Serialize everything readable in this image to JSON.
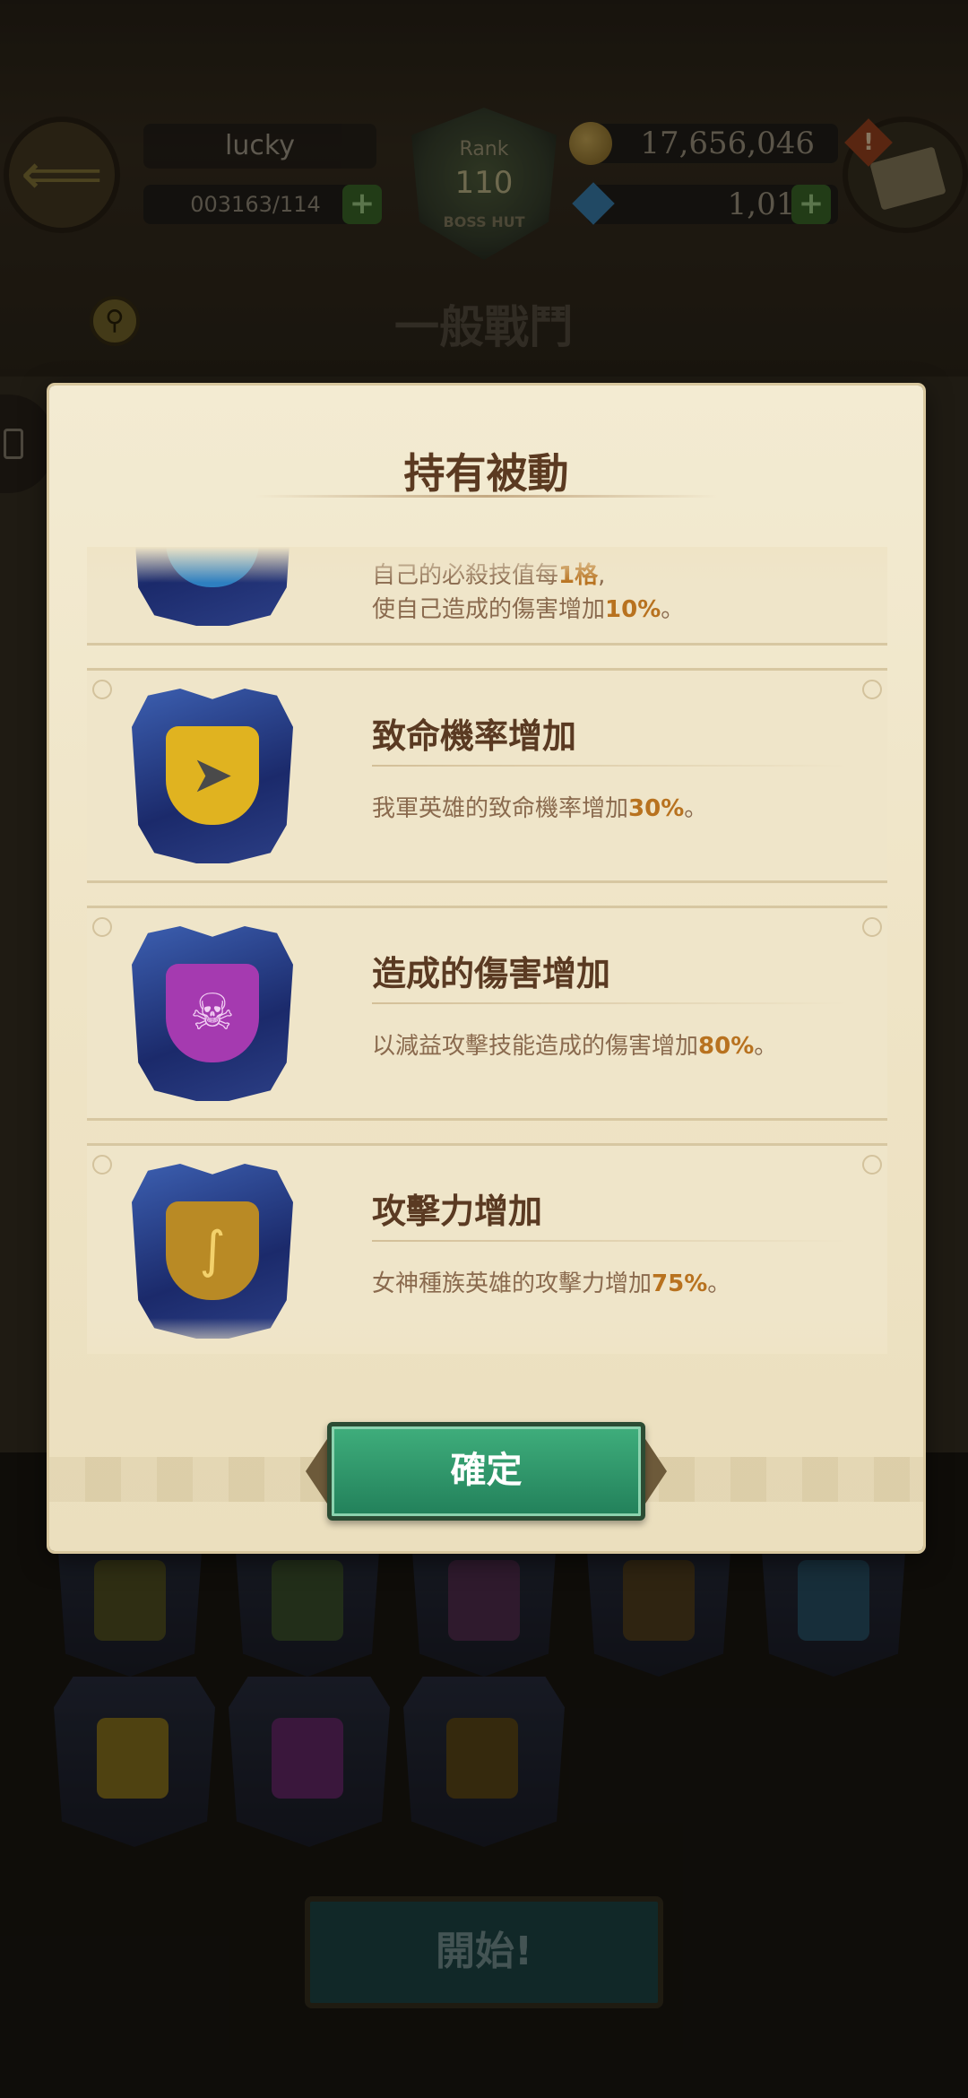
{
  "hud": {
    "username": "lucky",
    "stamina": "003163/114",
    "rank_label": "Rank",
    "rank_value": "110",
    "rank_sub": "BOSS HUT",
    "gold": "17,656,046",
    "gems": "1,011",
    "alert": "!"
  },
  "screen": {
    "title": "一般戰鬥",
    "start_label": "開始!"
  },
  "dialog": {
    "title": "持有被動",
    "confirm_label": "確定",
    "skills": [
      {
        "name": "",
        "desc_line1_pre": "自己的必殺技值每",
        "desc_line1_val": "1格",
        "desc_line1_post": ",",
        "desc_line2_pre": "使自己造成的傷害增加",
        "desc_line2_val": "10%",
        "desc_line2_post": "。",
        "icon": "blue-slash-icon",
        "icon_color": "#2e7fc0"
      },
      {
        "name": "致命機率增加",
        "desc_pre": "我軍英雄的致命機率增加",
        "desc_val": "30%",
        "desc_post": "。",
        "icon": "blade-icon",
        "icon_color": "#e0b320"
      },
      {
        "name": "造成的傷害增加",
        "desc_pre": "以減益攻擊技能造成的傷害增加",
        "desc_val": "80%",
        "desc_post": "。",
        "icon": "skull-dagger-icon",
        "icon_color": "#a53ab0"
      },
      {
        "name": "攻擊力增加",
        "desc_pre": "女神種族英雄的攻擊力增加",
        "desc_val": "75%",
        "desc_post": "。",
        "icon": "triskelion-shield-icon",
        "icon_color": "#b98a25"
      }
    ]
  },
  "colors": {
    "accent_value": "#b8721f",
    "title_text": "#5b3a21",
    "confirm_button": "#2f9a6c",
    "parchment": "#f0e6cb"
  }
}
